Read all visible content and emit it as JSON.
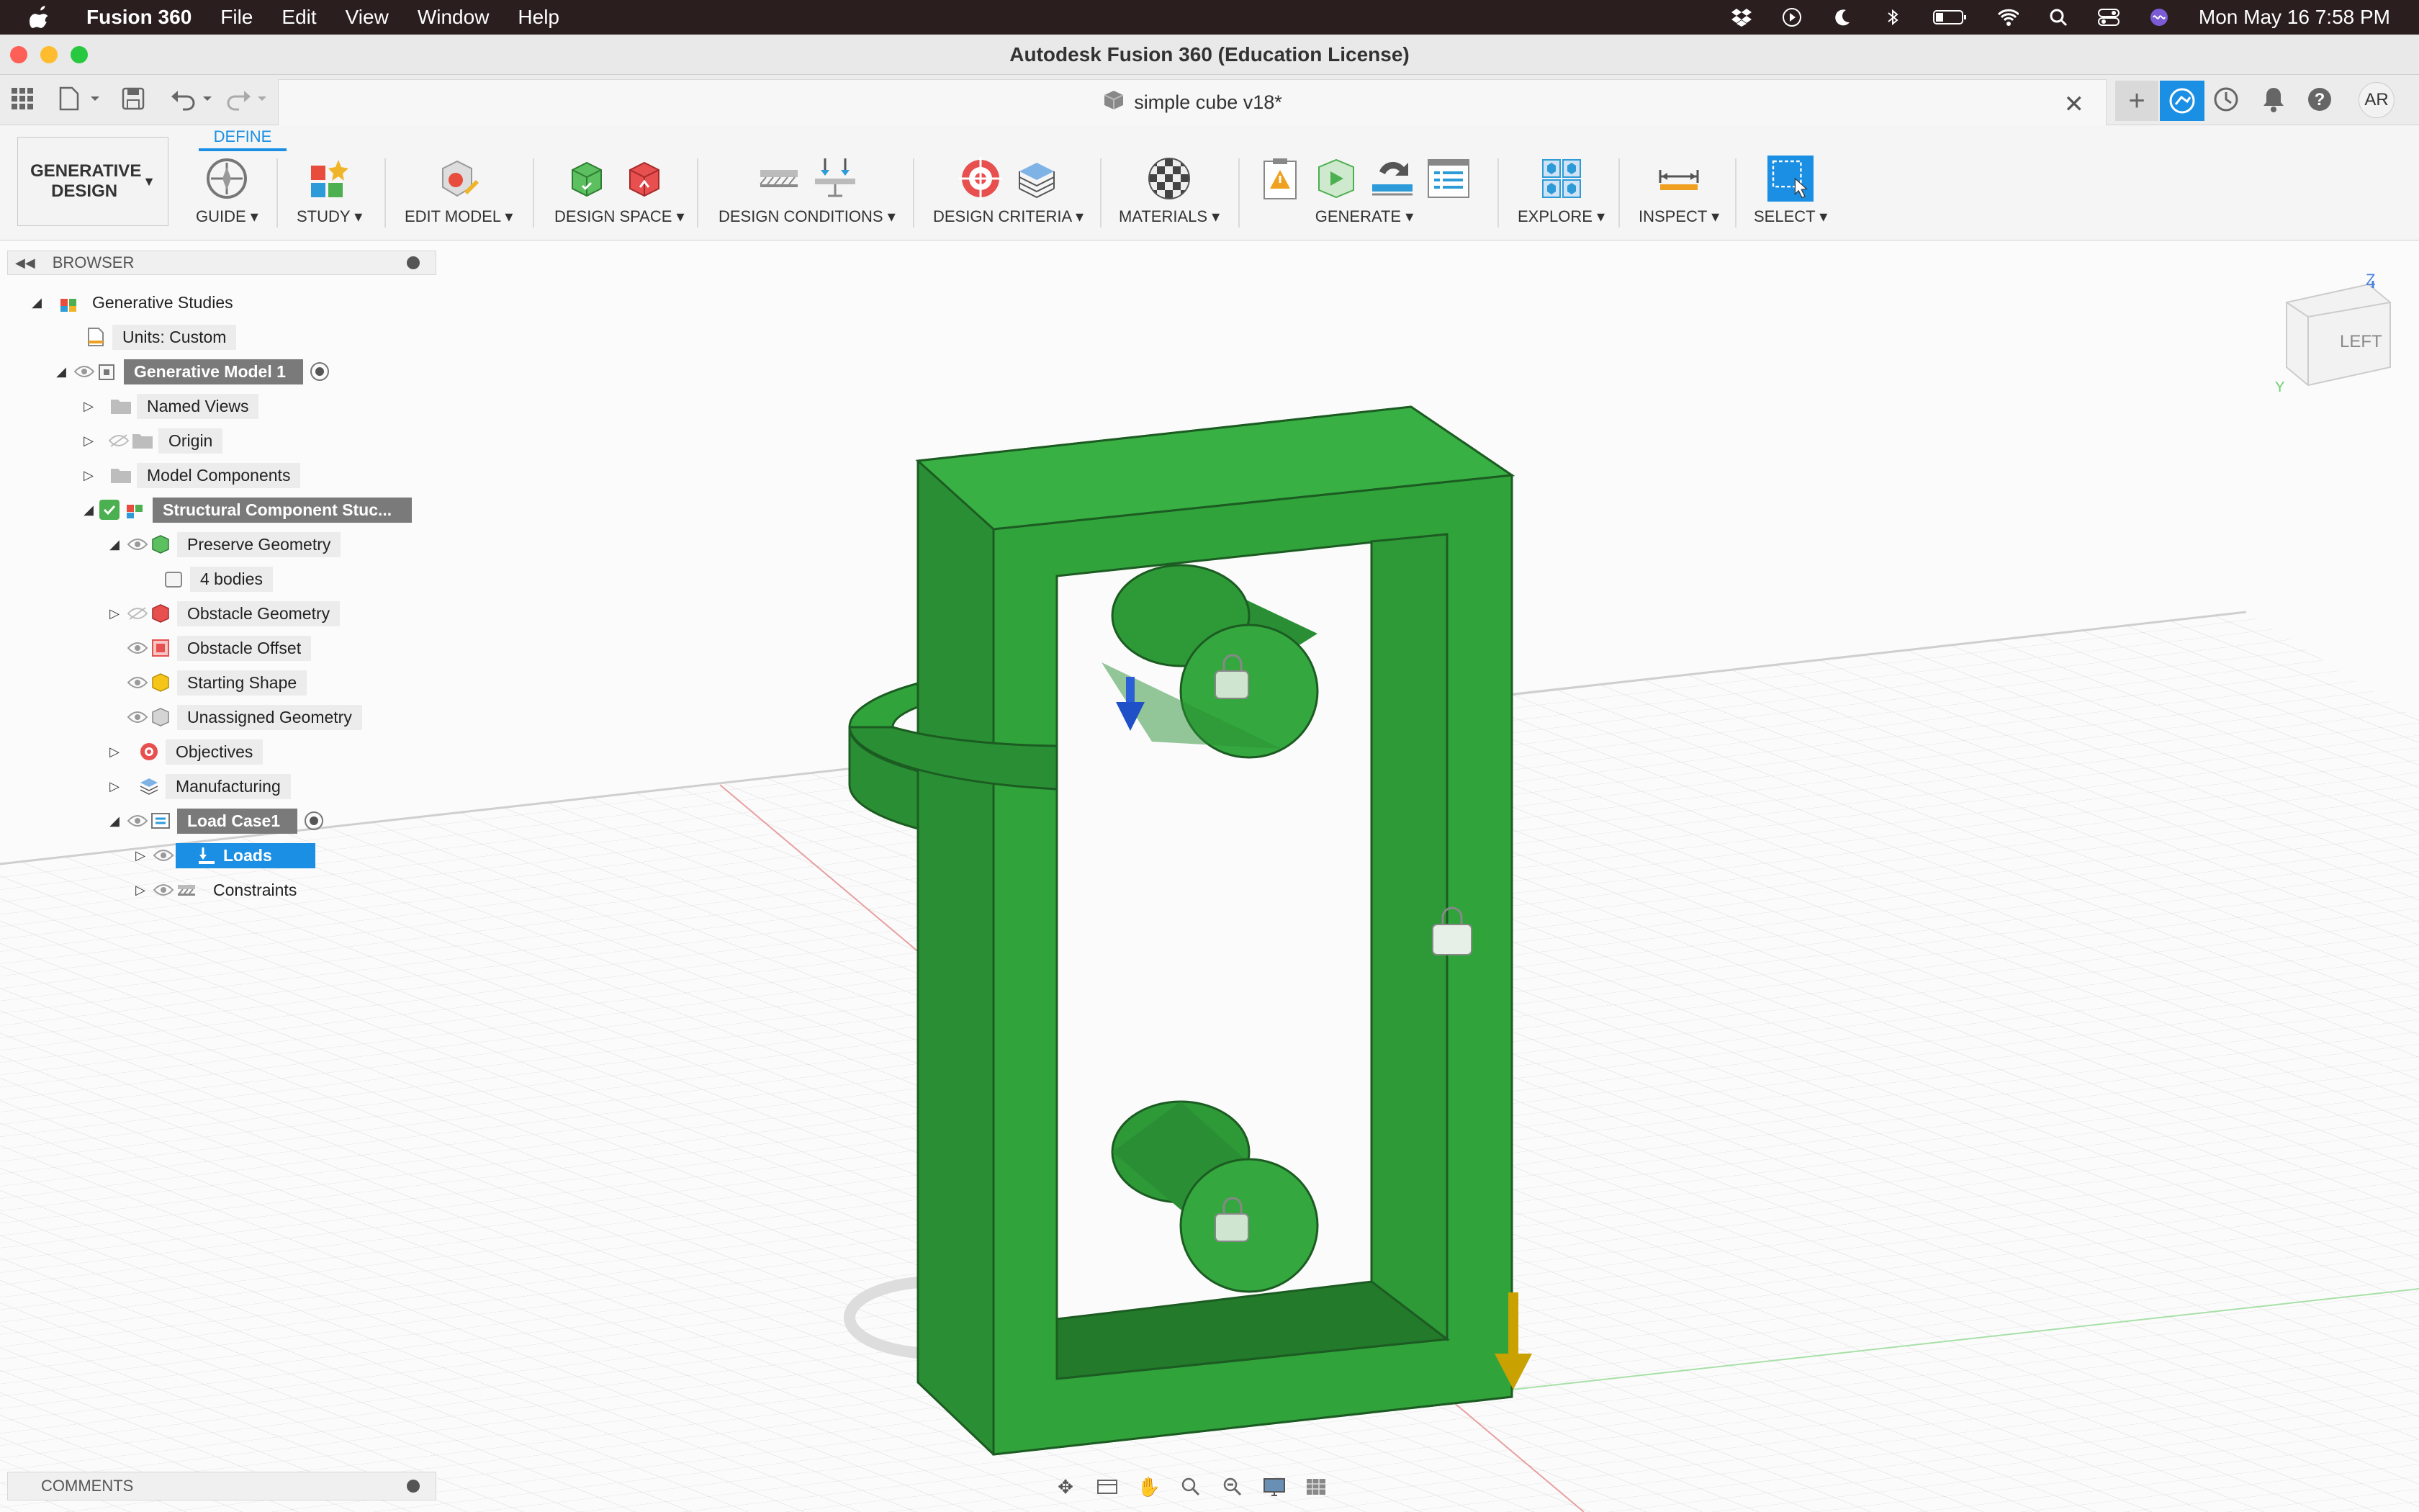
{
  "menubar": {
    "app": "Fusion 360",
    "items": [
      "File",
      "Edit",
      "View",
      "Window",
      "Help"
    ],
    "clock": "Mon May 16  7:58 PM"
  },
  "window": {
    "title": "Autodesk Fusion 360 (Education License)"
  },
  "tab": {
    "document": "simple cube v18*",
    "user": "AR"
  },
  "ribbon": {
    "workspace": "GENERATIVE DESIGN",
    "active_tab": "DEFINE",
    "groups": [
      "GUIDE",
      "STUDY",
      "EDIT MODEL",
      "DESIGN SPACE",
      "DESIGN CONDITIONS",
      "DESIGN CRITERIA",
      "MATERIALS",
      "GENERATE",
      "EXPLORE",
      "INSPECT",
      "SELECT"
    ]
  },
  "browser": {
    "title": "BROWSER",
    "items": [
      "Generative Studies",
      "Units: Custom",
      "Generative Model 1",
      "Named Views",
      "Origin",
      "Model Components",
      "Structural Component Stuc...",
      "Preserve Geometry",
      "4 bodies",
      "Obstacle Geometry",
      "Obstacle Offset",
      "Starting Shape",
      "Unassigned Geometry",
      "Objectives",
      "Manufacturing",
      "Load Case1",
      "Loads",
      "Constraints"
    ]
  },
  "comments": {
    "title": "COMMENTS"
  },
  "viewcube": {
    "face": "LEFT",
    "axis_z": "Z",
    "axis_y": "Y"
  },
  "colors": {
    "model": "#2e9a3a",
    "accent": "#1a8fe3",
    "menubar": "#2a1e1e"
  }
}
